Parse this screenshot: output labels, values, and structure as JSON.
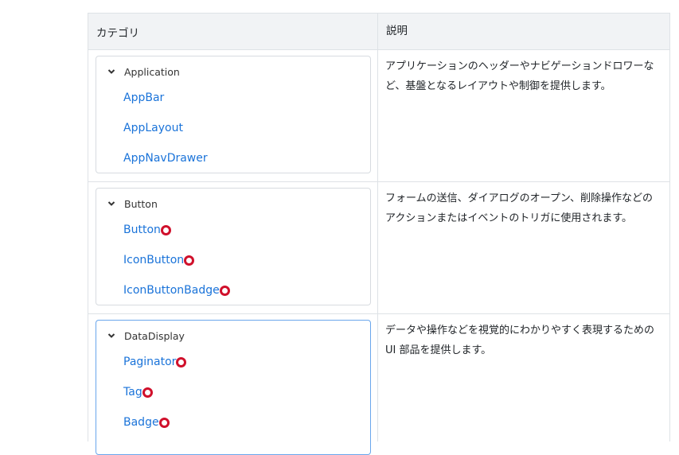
{
  "table": {
    "headers": {
      "category": "カテゴリ",
      "description": "説明"
    },
    "rows": [
      {
        "group": "Application",
        "items": [
          {
            "label": "AppBar",
            "marked": false
          },
          {
            "label": "AppLayout",
            "marked": false
          },
          {
            "label": "AppNavDrawer",
            "marked": false
          }
        ],
        "description": "アプリケーションのヘッダーやナビゲーションドロワーなど、基盤となるレイアウトや制御を提供します。"
      },
      {
        "group": "Button",
        "items": [
          {
            "label": "Button",
            "marked": true
          },
          {
            "label": "IconButton",
            "marked": true
          },
          {
            "label": "IconButtonBadge",
            "marked": true
          }
        ],
        "description": "フォームの送信、ダイアログのオープン、削除操作などのアクションまたはイベントのトリガに使用されます。"
      },
      {
        "group": "DataDisplay",
        "items": [
          {
            "label": "Paginator",
            "marked": true
          },
          {
            "label": "Tag",
            "marked": true
          },
          {
            "label": "Badge",
            "marked": true
          }
        ],
        "description": "データや操作などを視覚的にわかりやすく表現するためのUI 部品を提供します。"
      }
    ]
  },
  "colors": {
    "link": "#1a73d9",
    "marker": "#d0102b",
    "active_border": "#69a6ec"
  }
}
